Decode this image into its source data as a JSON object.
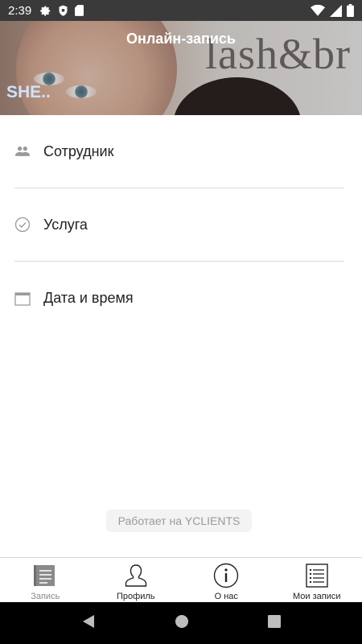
{
  "status_bar": {
    "time": "2:39",
    "icons_left": [
      "gear-icon",
      "shield-icon",
      "sd-card-icon"
    ],
    "icons_right": [
      "wifi-icon",
      "cellular-icon",
      "battery-icon"
    ]
  },
  "header": {
    "title": "Онлайн-запись",
    "salon_name": "SHE..",
    "background_text": "lash&br"
  },
  "menu": {
    "items": [
      {
        "label": "Сотрудник",
        "icon": "users-icon"
      },
      {
        "label": "Услуга",
        "icon": "check-circle-icon"
      },
      {
        "label": "Дата и время",
        "icon": "calendar-icon"
      }
    ]
  },
  "powered_by": "Работает на YCLIENTS",
  "bottom_nav": {
    "items": [
      {
        "label": "Запись",
        "icon": "notebook-icon",
        "active": true
      },
      {
        "label": "Профиль",
        "icon": "person-icon",
        "active": false
      },
      {
        "label": "О нас",
        "icon": "info-icon",
        "active": false
      },
      {
        "label": "Мои записи",
        "icon": "list-icon",
        "active": false
      }
    ]
  },
  "system_nav": [
    "back-icon",
    "home-icon",
    "recents-icon"
  ],
  "colors": {
    "status_bar_bg": "#3a3a3a",
    "divider": "#dcdcdc",
    "inactive_label": "#8a8a8a",
    "salon_name": "#cfe3ff"
  }
}
